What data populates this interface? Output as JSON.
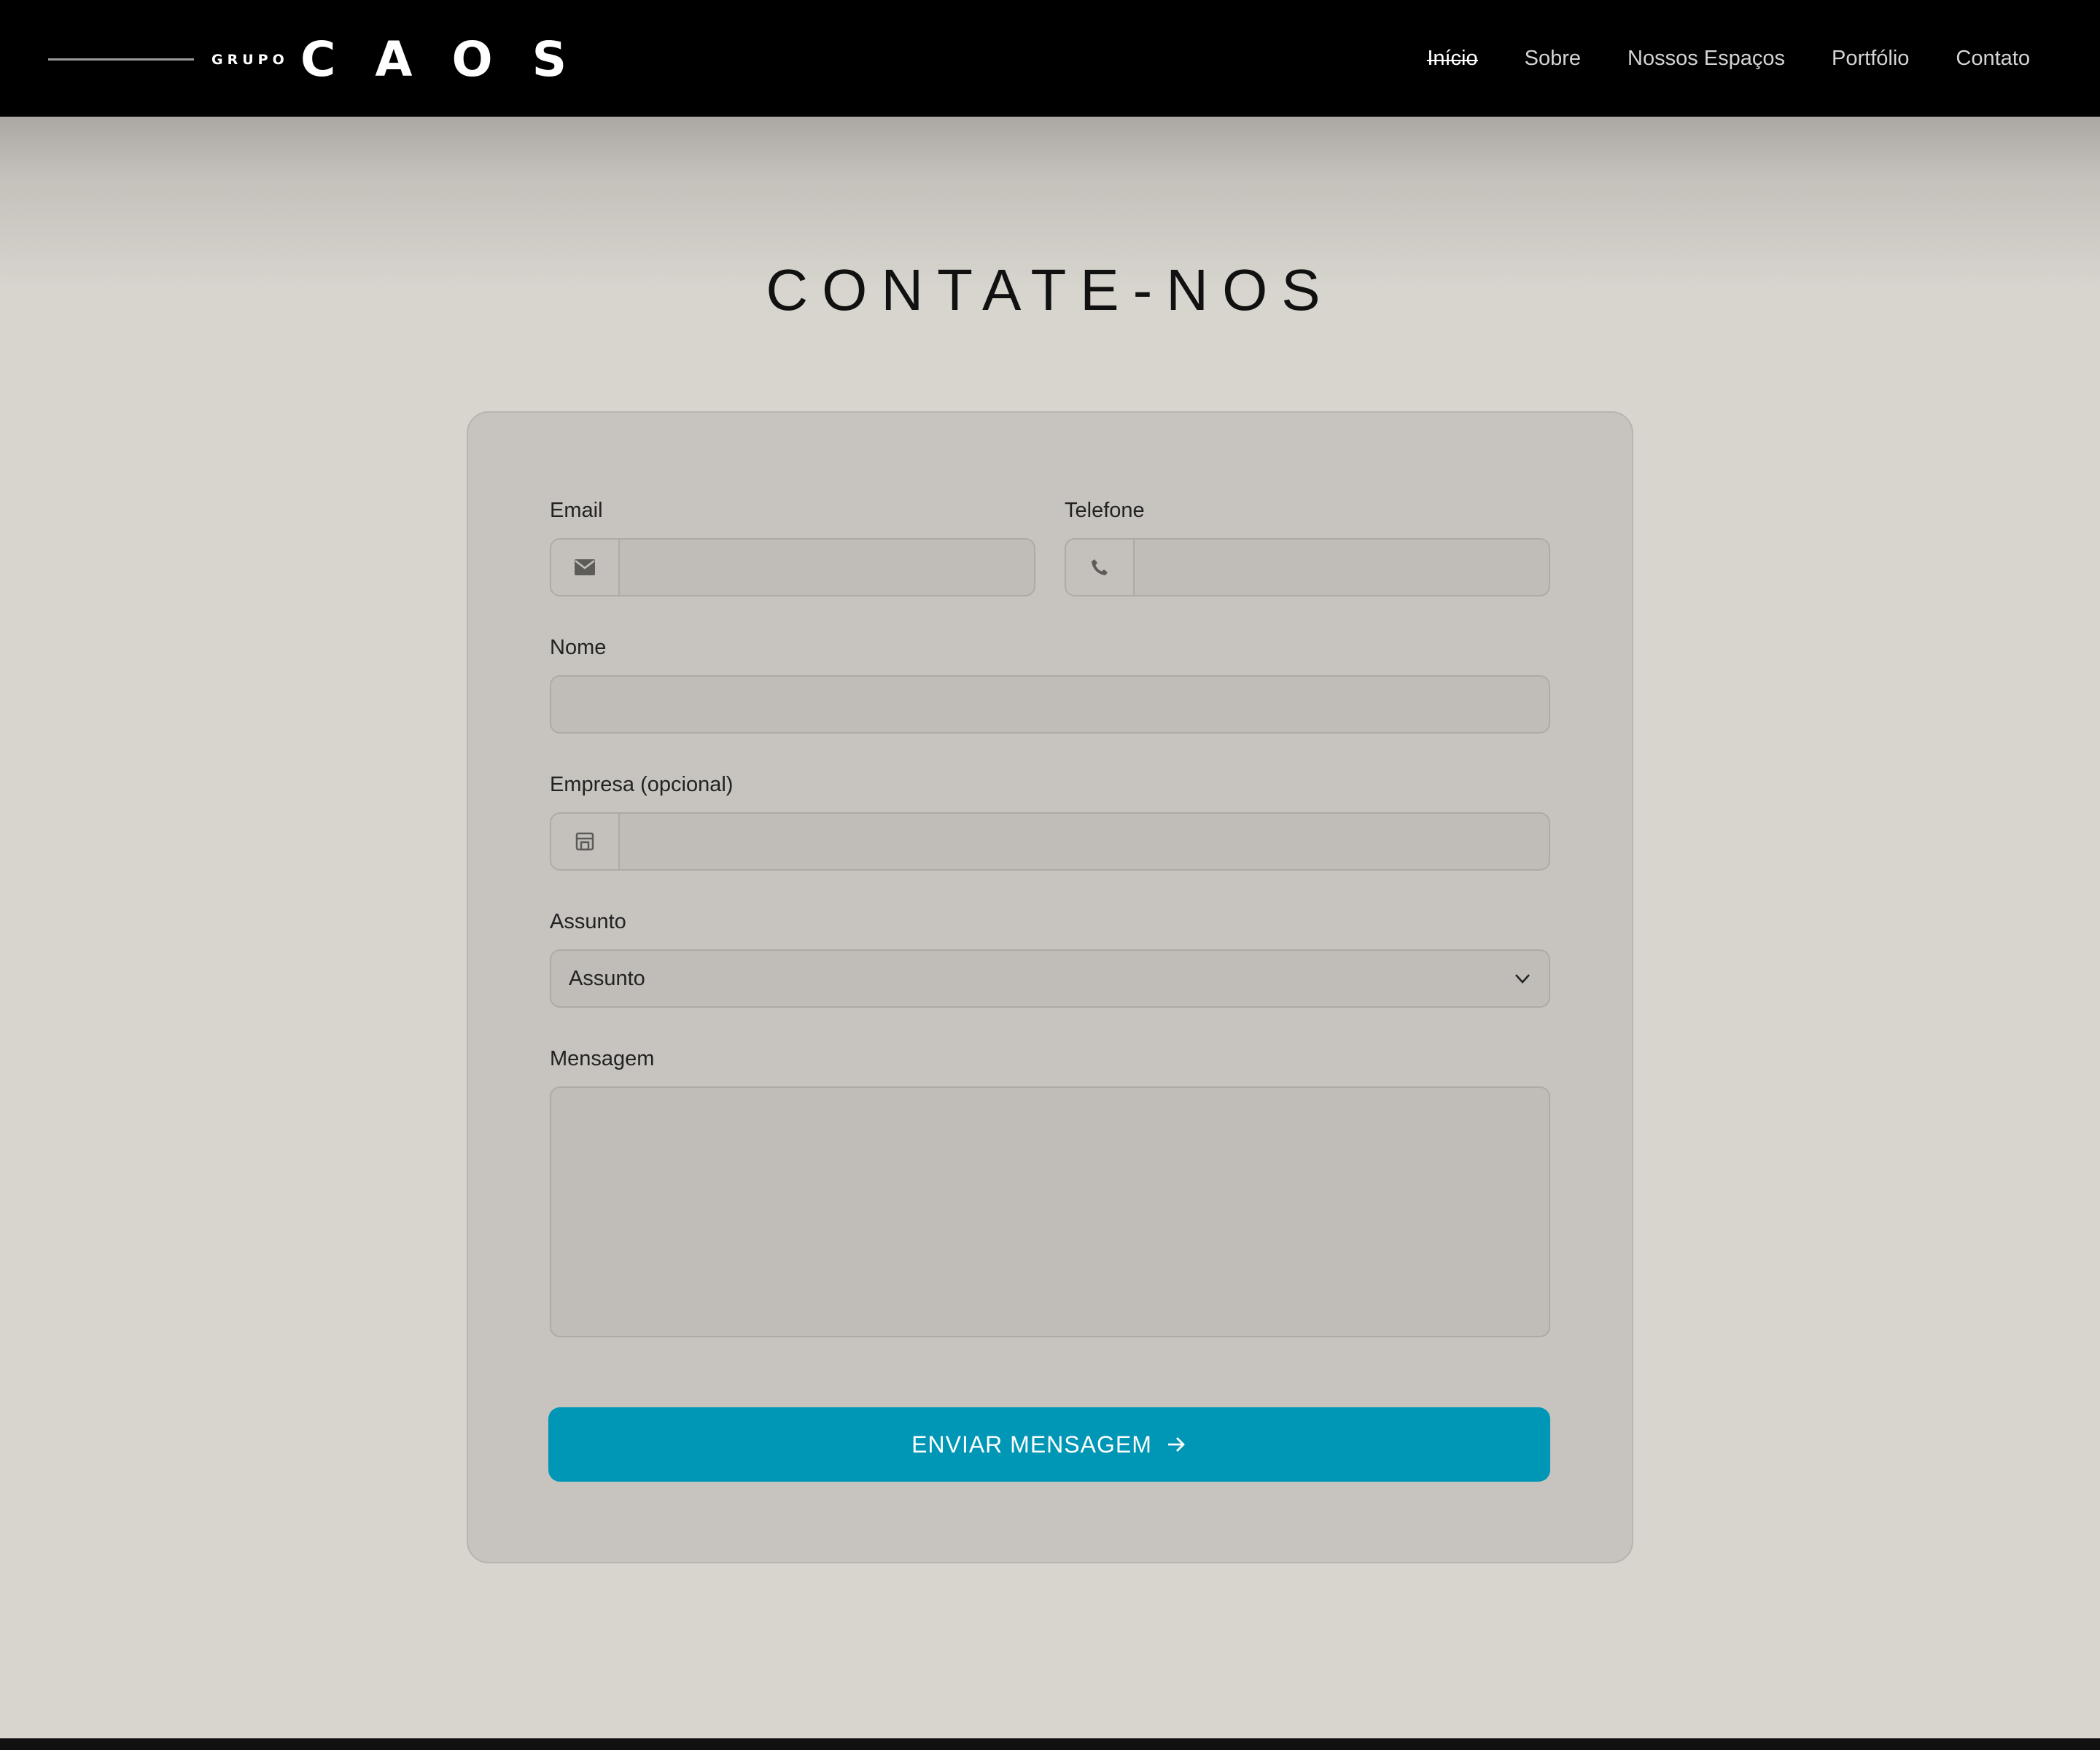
{
  "header": {
    "logo_small": "GRUPO",
    "logo_big": "CAOS",
    "nav": [
      {
        "label": "Início",
        "active": true
      },
      {
        "label": "Sobre",
        "active": false
      },
      {
        "label": "Nossos Espaços",
        "active": false
      },
      {
        "label": "Portfólio",
        "active": false
      },
      {
        "label": "Contato",
        "active": false
      }
    ]
  },
  "page": {
    "title": "CONTATE-NOS"
  },
  "form": {
    "email": {
      "label": "Email",
      "icon": "envelope-icon",
      "value": ""
    },
    "telefone": {
      "label": "Telefone",
      "icon": "phone-icon",
      "value": ""
    },
    "nome": {
      "label": "Nome",
      "value": ""
    },
    "empresa": {
      "label": "Empresa (opcional)",
      "icon": "store-icon",
      "value": ""
    },
    "assunto": {
      "label": "Assunto",
      "selected": "Assunto"
    },
    "mensagem": {
      "label": "Mensagem",
      "value": ""
    },
    "submit": {
      "label": "ENVIAR MENSAGEM",
      "icon": "arrow-right-icon"
    }
  },
  "colors": {
    "header_bg": "#000000",
    "page_bg": "#d8d5cf",
    "card_bg": "#c7c4bf",
    "accent": "#0096b6"
  }
}
